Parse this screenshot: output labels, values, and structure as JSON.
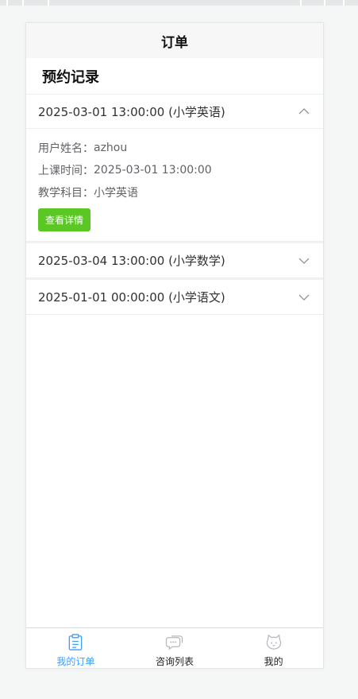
{
  "nav": {
    "title": "订单"
  },
  "section": {
    "title": "预约记录"
  },
  "orders": [
    {
      "header": "2025-03-01 13:00:00 (小学英语)",
      "expanded": true,
      "details": {
        "user_label": "用户姓名：",
        "user_value": "azhou",
        "time_label": "上课时间：",
        "time_value": "2025-03-01 13:00:00",
        "subject_label": "教学科目：",
        "subject_value": "小学英语"
      },
      "button_label": "查看详情"
    },
    {
      "header": "2025-03-04 13:00:00 (小学数学)",
      "expanded": false
    },
    {
      "header": "2025-01-01 00:00:00 (小学语文)",
      "expanded": false
    }
  ],
  "tabbar": {
    "items": [
      {
        "label": "我的订单",
        "icon": "clipboard-icon",
        "active": true
      },
      {
        "label": "咨询列表",
        "icon": "chat-icon",
        "active": false
      },
      {
        "label": "我的",
        "icon": "cat-face-icon",
        "active": false
      }
    ]
  },
  "colors": {
    "accent": "#3c9cff",
    "button_green": "#5ac725"
  }
}
